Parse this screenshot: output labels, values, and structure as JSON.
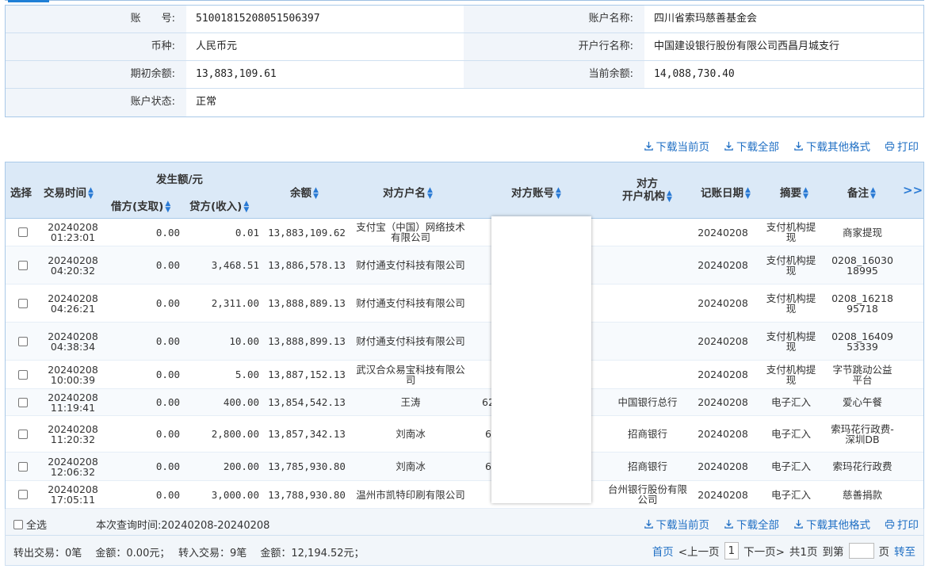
{
  "account": {
    "account_no_label": "账　　号:",
    "account_no": "51001815208051506397",
    "account_name_label": "账户名称:",
    "account_name": "四川省索玛慈善基金会",
    "currency_label": "币种:",
    "currency": "人民币元",
    "bank_label": "开户行名称:",
    "bank": "中国建设银行股份有限公司西昌月城支行",
    "opening_label": "期初余额:",
    "opening": "13,883,109.61",
    "current_label": "当前余额:",
    "current": "14,088,730.40",
    "status_label": "账户状态:",
    "status": "正常"
  },
  "toolbar": {
    "download_page": "下载当前页",
    "download_all": "下载全部",
    "download_other": "下载其他格式",
    "print": "打印"
  },
  "headers": {
    "select": "选择",
    "time": "交易时间",
    "amount_group": "发生额/元",
    "debit": "借方(支取)",
    "credit": "贷方(收入)",
    "balance": "余额",
    "party_name": "对方户名",
    "party_acct": "对方账号",
    "party_bank_1": "对方",
    "party_bank_2": "开户机构",
    "post_date": "记账日期",
    "summary": "摘要",
    "remark": "备注",
    "more": ">>"
  },
  "rows": [
    {
      "date": "20240208",
      "time": "01:23:01",
      "debit": "0.00",
      "credit": "0.01",
      "balance": "13,883,109.62",
      "party": "支付宝（中国）网络技术有限公司",
      "acct": "",
      "bank": "",
      "post": "20240208",
      "summary": "支付机构提现",
      "remark": "商家提现"
    },
    {
      "date": "20240208",
      "time": "04:20:32",
      "debit": "0.00",
      "credit": "3,468.51",
      "balance": "13,886,578.13",
      "party": "财付通支付科技有限公司",
      "acct": "",
      "bank": "",
      "post": "20240208",
      "summary": "支付机构提现",
      "remark": "0208_16030 18995"
    },
    {
      "date": "20240208",
      "time": "04:26:21",
      "debit": "0.00",
      "credit": "2,311.00",
      "balance": "13,888,889.13",
      "party": "财付通支付科技有限公司",
      "acct": "",
      "bank": "",
      "post": "20240208",
      "summary": "支付机构提现",
      "remark": "0208_16218 95718"
    },
    {
      "date": "20240208",
      "time": "04:38:34",
      "debit": "0.00",
      "credit": "10.00",
      "balance": "13,888,899.13",
      "party": "财付通支付科技有限公司",
      "acct": "",
      "bank": "",
      "post": "20240208",
      "summary": "支付机构提现",
      "remark": "0208_16409 53339"
    },
    {
      "date": "20240208",
      "time": "10:00:39",
      "debit": "0.00",
      "credit": "5.00",
      "balance": "13,887,152.13",
      "party": "武汉合众易宝科技有限公司",
      "acct": "",
      "bank": "",
      "post": "20240208",
      "summary": "支付机构提现",
      "remark": "字节跳动公益平台"
    },
    {
      "date": "20240208",
      "time": "11:19:41",
      "debit": "0.00",
      "credit": "400.00",
      "balance": "13,854,542.13",
      "party": "王涛",
      "acct": "62",
      "bank": "中国银行总行",
      "post": "20240208",
      "summary": "电子汇入",
      "remark": "爱心午餐"
    },
    {
      "date": "20240208",
      "time": "11:20:32",
      "debit": "0.00",
      "credit": "2,800.00",
      "balance": "13,857,342.13",
      "party": "刘南冰",
      "acct": "6",
      "bank": "招商银行",
      "post": "20240208",
      "summary": "电子汇入",
      "remark": "索玛花行政费-深圳DB"
    },
    {
      "date": "20240208",
      "time": "12:06:32",
      "debit": "0.00",
      "credit": "200.00",
      "balance": "13,785,930.80",
      "party": "刘南冰",
      "acct": "6",
      "bank": "招商银行",
      "post": "20240208",
      "summary": "电子汇入",
      "remark": "索玛花行政费"
    },
    {
      "date": "20240208",
      "time": "17:05:11",
      "debit": "0.00",
      "credit": "3,000.00",
      "balance": "13,788,930.80",
      "party": "温州市凯特印刷有限公司",
      "acct": "",
      "bank": "台州银行股份有限公司",
      "post": "20240208",
      "summary": "电子汇入",
      "remark": "慈善捐款"
    }
  ],
  "footer": {
    "select_all": "全选",
    "query_range": "本次查询时间:20240208-20240208",
    "summary_line": "转出交易：0笔　 金额：0.00元；　 转入交易：9笔　 金额：12,194.52元；",
    "first": "首页",
    "prev": "<上一页",
    "page": "1",
    "next": "下一页>",
    "total": "共1页",
    "goto": "到第",
    "page_unit": "页",
    "go": "转至"
  }
}
